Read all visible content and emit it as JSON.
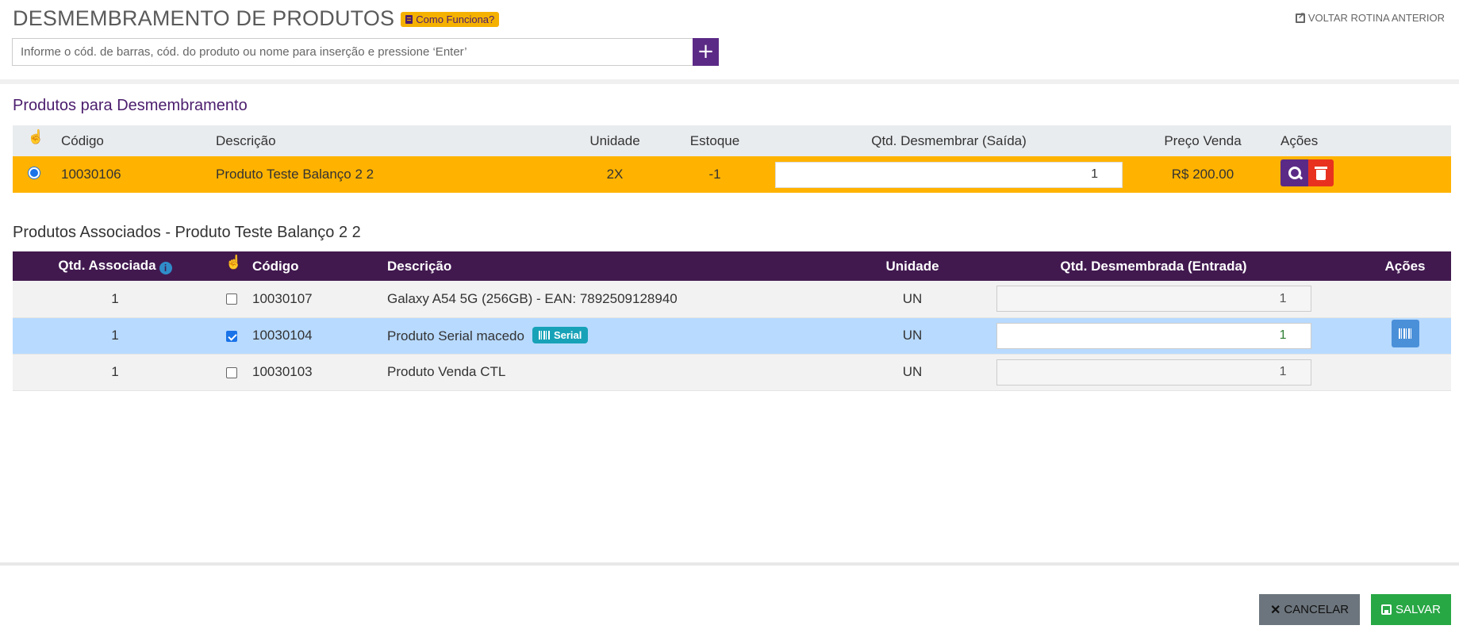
{
  "header": {
    "title": "DESMEMBRAMENTO DE PRODUTOS",
    "help_label": "Como Funciona?",
    "back_link": "VOLTAR ROTINA ANTERIOR",
    "search_placeholder": "Informe o cód. de barras, cód. do produto ou nome para inserção e pressione ‘Enter’",
    "add_button": "+"
  },
  "section1": {
    "title": "Produtos para Desmembramento",
    "columns": [
      "Código",
      "Descrição",
      "Unidade",
      "Estoque",
      "Qtd. Desmembrar (Saída)",
      "Preço Venda",
      "Ações"
    ],
    "rows": [
      {
        "codigo": "10030106",
        "descricao": "Produto Teste Balanço 2 2",
        "unidade": "2X",
        "estoque": "-1",
        "qtd": "1",
        "preco": "R$ 200.00"
      }
    ],
    "row_color": "#ffb300"
  },
  "section2": {
    "title": "Produtos Associados - Produto Teste Balanço 2 2",
    "columns": [
      "Qtd. Associada",
      "Código",
      "Descrição",
      "Unidade",
      "Qtd. Desmembrada (Entrada)",
      "Ações"
    ],
    "rows": [
      {
        "qtd_assoc": "1",
        "checked": false,
        "codigo": "10030107",
        "descricao": "Galaxy A54 5G (256GB) - EAN: 7892509128940",
        "unidade": "UN",
        "qtd": "1"
      },
      {
        "qtd_assoc": "1",
        "checked": true,
        "codigo": "10030104",
        "descricao": "Produto Serial macedo",
        "badge": "Serial",
        "unidade": "UN",
        "qtd": "1"
      },
      {
        "qtd_assoc": "1",
        "checked": false,
        "codigo": "10030103",
        "descricao": "Produto Venda CTL",
        "unidade": "UN",
        "qtd": "1"
      }
    ],
    "header_color": "#41194f"
  },
  "footer": {
    "cancel_label": "CANCELAR",
    "save_label": "SALVAR"
  },
  "icons": {
    "help": "book-icon",
    "back": "external-link-icon",
    "select": "hand-pointer-icon",
    "info": "info-circle-icon",
    "search": "search-icon",
    "delete": "trash-icon",
    "serial": "barcode-icon",
    "cancel": "close-icon",
    "save": "floppy-disk-icon"
  }
}
